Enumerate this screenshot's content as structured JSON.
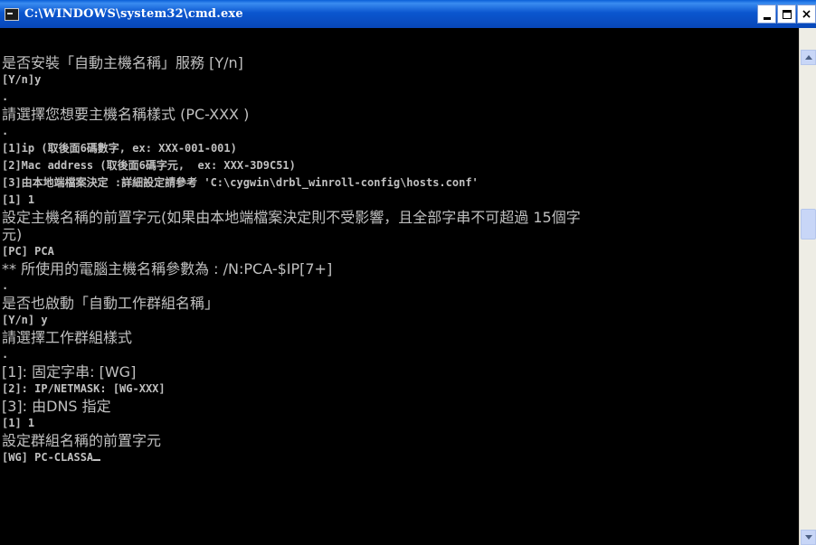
{
  "window": {
    "title": "C:\\WINDOWS\\system32\\cmd.exe",
    "icon": "cmd-console-icon",
    "controls": {
      "minimize": "minimize-icon",
      "maximize": "maximize-icon",
      "close": "close-icon"
    }
  },
  "console": {
    "rule": "================================================",
    "lines": [
      "是否安裝「自動主機名稱」服務 [Y/n]",
      "[Y/n]y",
      ".",
      "請選擇您想要主機名稱樣式 (PC-XXX )",
      ".",
      "[1]ip (取後面6碼數字, ex: XXX-001-001)",
      "[2]Mac address (取後面6碼字元,  ex: XXX-3D9C51)",
      "[3]由本地端檔案決定 :詳細設定請參考 'C:\\cygwin\\drbl_winroll-config\\hosts.conf'",
      "[1] 1",
      "設定主機名稱的前置字元(如果由本地端檔案決定則不受影響，且全部字串不可超過 15個字",
      "元)",
      "[PC] PCA",
      "** 所使用的電腦主機名稱參數為 : /N:PCA-$IP[7+]",
      ".",
      "是否也啟動「自動工作群組名稱」",
      "[Y/n] y",
      "請選擇工作群組樣式",
      ".",
      "[1]: 固定字串: [WG]",
      "[2]: IP/NETMASK: [WG-XXX]",
      "[3]: 由DNS 指定",
      "[1] 1",
      "設定群組名稱的前置字元",
      "[WG] PC-CLASSA"
    ]
  },
  "scrollbar": {
    "up_icon": "scroll-up-arrow-icon",
    "down_icon": "scroll-down-arrow-icon"
  },
  "colors": {
    "console_bg": "#000000",
    "console_text": "#c0c0c0",
    "titlebar": "#0b56cf"
  }
}
